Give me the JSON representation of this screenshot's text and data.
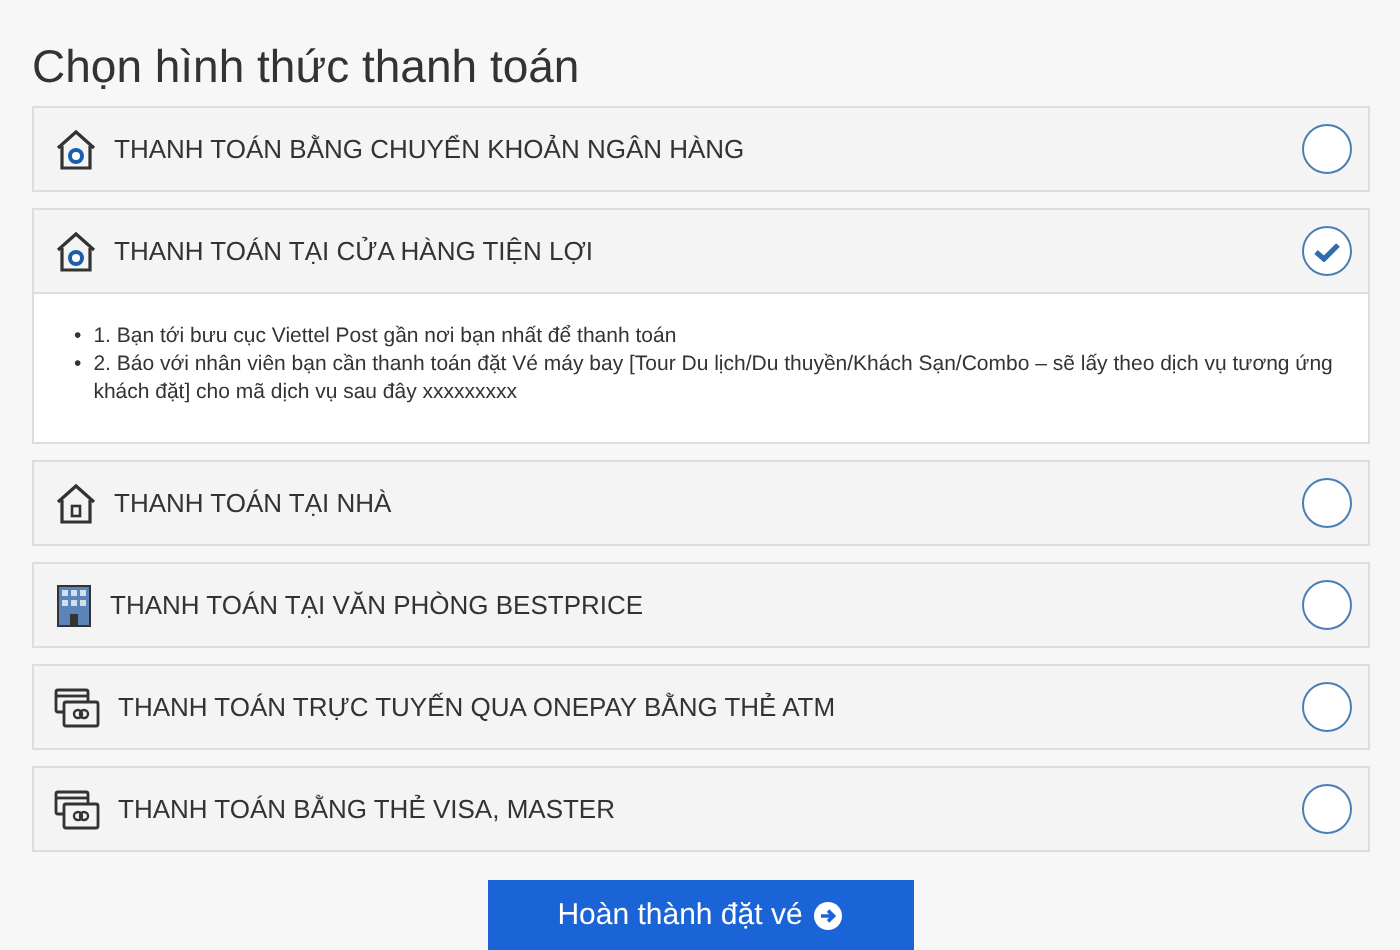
{
  "title": "Chọn hình thức thanh toán",
  "options": [
    {
      "label": "THANH TOÁN BẰNG CHUYỂN KHOẢN NGÂN HÀNG",
      "kind": "bank",
      "selected": false
    },
    {
      "label": "THANH TOÁN TẠI CỬA HÀNG TIỆN LỢI",
      "kind": "bank",
      "selected": true,
      "details": [
        {
          "bullet": "•",
          "text": "1. Bạn tới bưu cục Viettel Post gần nơi bạn nhất để thanh toán"
        },
        {
          "bullet": "•",
          "text": "2. Báo với nhân viên bạn cần thanh toán đặt Vé máy bay [Tour Du lịch/Du thuyền/Khách Sạn/Combo – sẽ lấy theo dịch vụ tương ứng khách đặt] cho mã dịch vụ sau đây xxxxxxxxx"
        }
      ]
    },
    {
      "label": "THANH TOÁN TẠI NHÀ",
      "kind": "house",
      "selected": false
    },
    {
      "label": "THANH TOÁN TẠI VĂN PHÒNG BESTPRICE",
      "kind": "office",
      "selected": false
    },
    {
      "label": "THANH TOÁN TRỰC TUYẾN QUA ONEPAY BẰNG THẺ ATM",
      "kind": "card",
      "selected": false
    },
    {
      "label": "THANH TOÁN BẰNG THẺ VISA, MASTER",
      "kind": "card",
      "selected": false
    }
  ],
  "submit": "Hoàn thành đặt vé"
}
